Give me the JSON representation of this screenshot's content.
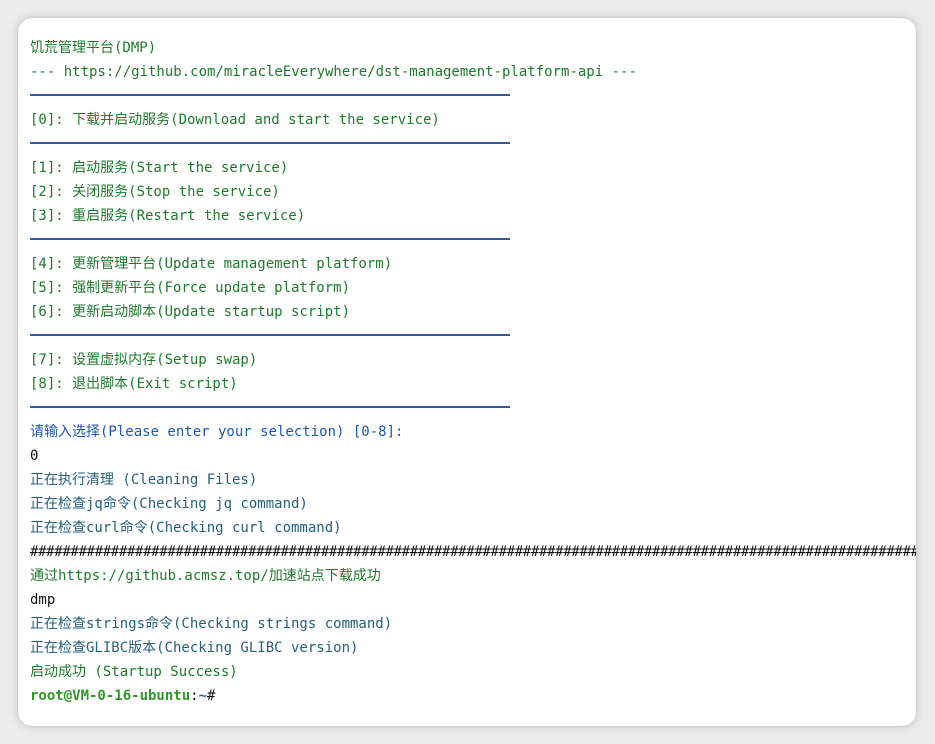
{
  "header": {
    "title": "饥荒管理平台(DMP)",
    "repo": "--- https://github.com/miracleEverywhere/dst-management-platform-api ---"
  },
  "menu": {
    "opt0": "[0]: 下载并启动服务(Download and start the service)",
    "opt1": "[1]: 启动服务(Start the service)",
    "opt2": "[2]: 关闭服务(Stop the service)",
    "opt3": "[3]: 重启服务(Restart the service)",
    "opt4": "[4]: 更新管理平台(Update management platform)",
    "opt5": "[5]: 强制更新平台(Force update platform)",
    "opt6": "[6]: 更新启动脚本(Update startup script)",
    "opt7": "[7]: 设置虚拟内存(Setup swap)",
    "opt8": "[8]: 退出脚本(Exit script)"
  },
  "input": {
    "prompt": "请输入选择(Please enter your selection) [0-8]:",
    "value": "0"
  },
  "output": {
    "cleaning": "正在执行清理 (Cleaning Files)",
    "jq": "正在检查jq命令(Checking jq command)",
    "curl": "正在检查curl命令(Checking curl command)",
    "progress": "##################################################################################################################",
    "download": "通过https://github.acmsz.top/加速站点下载成功",
    "dmp": "dmp",
    "strings": "正在检查strings命令(Checking strings command)",
    "glibc": "正在检查GLIBC版本(Checking GLIBC version)",
    "success": "启动成功 (Startup Success)"
  },
  "shell_prompt": {
    "user_host": "root@VM-0-16-ubuntu",
    "sep": ":",
    "path": "~",
    "symbol": "#"
  },
  "colors": {
    "menu_text": "#1f7a2e",
    "separator": "#2a5aa8",
    "input_prompt": "#1e58b4",
    "status_text": "#26607a",
    "prompt_user": "#2e9a26"
  }
}
